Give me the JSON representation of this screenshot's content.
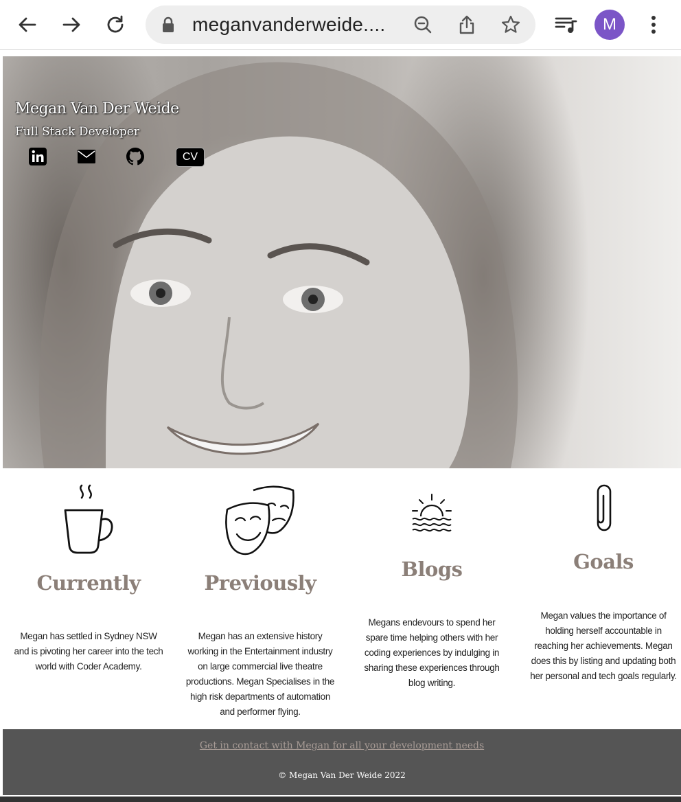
{
  "browser": {
    "url": "meganvanderweide....",
    "profile_initial": "M"
  },
  "hero": {
    "name": "Megan Van Der Weide",
    "subtitle": "Full Stack Developer",
    "cv_label": "CV",
    "social_icons": [
      "linkedin-icon",
      "email-icon",
      "github-icon"
    ]
  },
  "cards": [
    {
      "icon": "coffee-cup-icon",
      "heading": "Currently",
      "text": "Megan has settled in Sydney NSW and is pivoting her career into the tech world with Coder Academy."
    },
    {
      "icon": "theatre-masks-icon",
      "heading": "Previously",
      "text": "Megan has an extensive history working in the Entertainment industry on large commercial live theatre productions. Megan Specialises in the high risk departments of automation and performer flying."
    },
    {
      "icon": "sunset-waves-icon",
      "heading": "Blogs",
      "text": "Megans endevours to spend her spare time helping others with her coding experiences by indulging in sharing these experiences through blog writing."
    },
    {
      "icon": "paperclip-icon",
      "heading": "Goals",
      "text": "Megan values the importance of holding herself accountable in reaching her achievements. Megan does this by listing and updating both her personal and tech goals regularly."
    }
  ],
  "footer": {
    "contact_link": "Get in contact with Megan for all your development needs",
    "copyright": "© Megan Van Der Weide 2022"
  },
  "colors": {
    "heading": "#8b7f78",
    "footer_bg": "#555555",
    "avatar": "#7b55c7"
  }
}
